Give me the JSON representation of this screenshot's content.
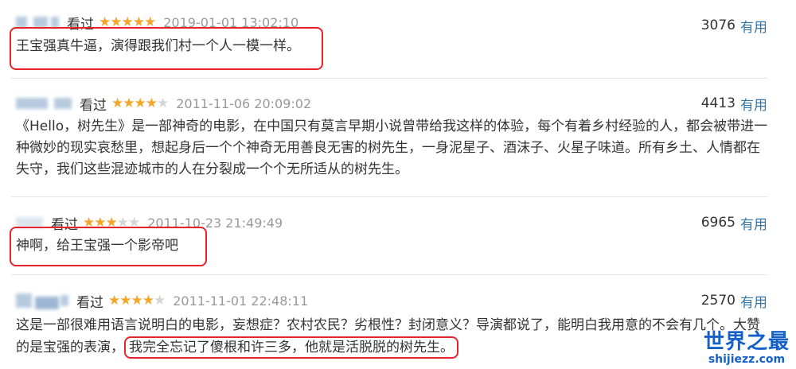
{
  "reviews": [
    {
      "watched": "看过",
      "stars": 5,
      "time": "2019-01-01 13:02:10",
      "votes": "3076",
      "useful_label": "有用",
      "text": "王宝强真牛逼，演得跟我们村一个人一模一样。"
    },
    {
      "watched": "看过",
      "stars": 4,
      "time": "2011-11-06 20:09:02",
      "votes": "4413",
      "useful_label": "有用",
      "text": "《Hello，树先生》是一部神奇的电影，在中国只有莫言早期小说曾带给我这样的体验，每个有着乡村经验的人，都会被带进一种微妙的现实哀愁里，想起身后一个个神奇无用善良无害的树先生，一身泥星子、酒沫子、火星子味道。所有乡土、人情都在失守，我们这些混迹城市的人在分裂成一个个无所适从的树先生。"
    },
    {
      "watched": "看过",
      "stars": 3,
      "time": "2011-10-23 21:49:49",
      "votes": "6965",
      "useful_label": "有用",
      "text": "神啊，给王宝强一个影帝吧"
    },
    {
      "watched": "看过",
      "stars": 4,
      "time": "2011-11-01 22:48:11",
      "votes": "2570",
      "useful_label": "有用",
      "text_before": "这是一部很难用语言说明白的电影，妄想症？农村农民？劣根性？封闭意义？导演都说了，能明白我用意的不会有几个。大赞的是宝强的表演，",
      "text_highlight": "我完全忘记了傻根和许三多，他就是活脱脱的树先生。"
    }
  ],
  "watermark": {
    "cn": "世界之最",
    "en": "shijiezz.com"
  },
  "colors": {
    "highlight": "#e8232a",
    "link": "#3377aa",
    "star": "#f4a62a"
  }
}
